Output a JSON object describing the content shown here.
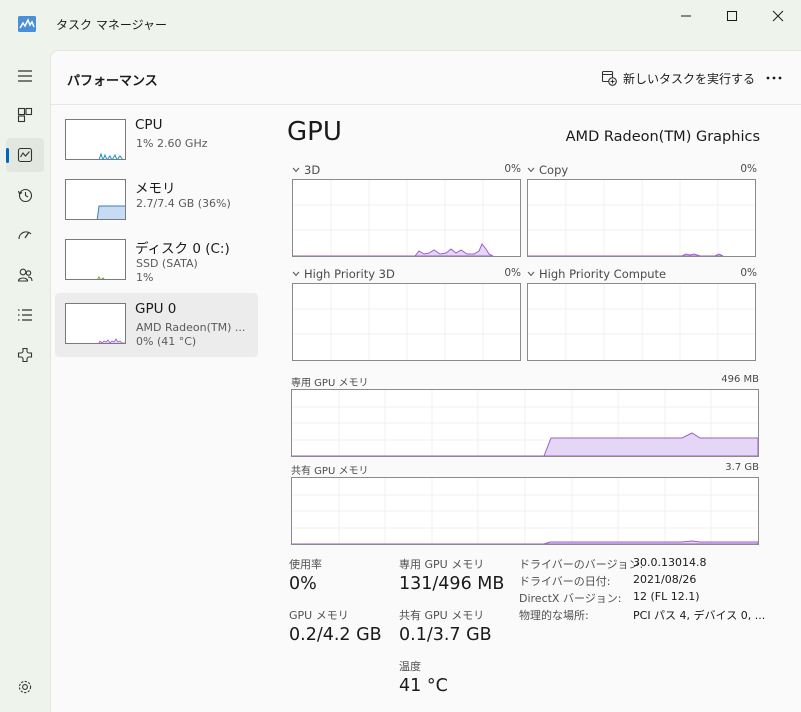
{
  "window": {
    "title": "タスク マネージャー"
  },
  "header": {
    "title": "パフォーマンス",
    "run_task_label": "新しいタスクを実行する"
  },
  "nav": [
    "menu-icon",
    "processes-icon",
    "performance-icon",
    "history-icon",
    "startup-icon",
    "users-icon",
    "details-icon",
    "services-icon",
    "settings-icon"
  ],
  "resources": [
    {
      "name": "CPU",
      "line1": "1%  2.60 GHz"
    },
    {
      "name": "メモリ",
      "line1": "2.7/7.4 GB (36%)"
    },
    {
      "name": "ディスク 0 (C:)",
      "line1": "SSD (SATA)",
      "line2": "1%"
    },
    {
      "name": "GPU 0",
      "line1": "AMD Radeon(TM) ...",
      "line2": "0%  (41 °C)"
    }
  ],
  "gpu": {
    "title": "GPU",
    "model": "AMD Radeon(TM) Graphics",
    "engines": [
      {
        "label": "3D",
        "value": "0%"
      },
      {
        "label": "Copy",
        "value": "0%"
      },
      {
        "label": "High Priority 3D",
        "value": "0%"
      },
      {
        "label": "High Priority Compute",
        "value": "0%"
      }
    ],
    "dedicated": {
      "label": "専用 GPU メモリ",
      "max": "496 MB"
    },
    "shared": {
      "label": "共有 GPU メモリ",
      "max": "3.7 GB"
    }
  },
  "stats": {
    "usage": {
      "label": "使用率",
      "value": "0%"
    },
    "dedicated_mem": {
      "label": "専用 GPU メモリ",
      "value": "131/496 MB"
    },
    "gpu_mem": {
      "label": "GPU メモリ",
      "value": "0.2/4.2 GB"
    },
    "shared_mem": {
      "label": "共有 GPU メモリ",
      "value": "0.1/3.7 GB"
    },
    "temperature": {
      "label": "温度",
      "value": "41 °C"
    }
  },
  "details": [
    {
      "key": "ドライバーのバージョン:",
      "value": "30.0.13014.8"
    },
    {
      "key": "ドライバーの日付:",
      "value": "2021/08/26"
    },
    {
      "key": "DirectX バージョン:",
      "value": "12 (FL 12.1)"
    },
    {
      "key": "物理的な場所:",
      "value": "PCI パス 4, デバイス 0, ..."
    }
  ],
  "colors": {
    "gpu_line": "#9a5fd1",
    "gpu_fill": "#e6d6f5",
    "cpu_line": "#1f8fc6",
    "mem_fill": "#c7dcf2",
    "mem_line": "#3a7cc4",
    "disk_line": "#74a836",
    "accent": "#0067c0"
  }
}
